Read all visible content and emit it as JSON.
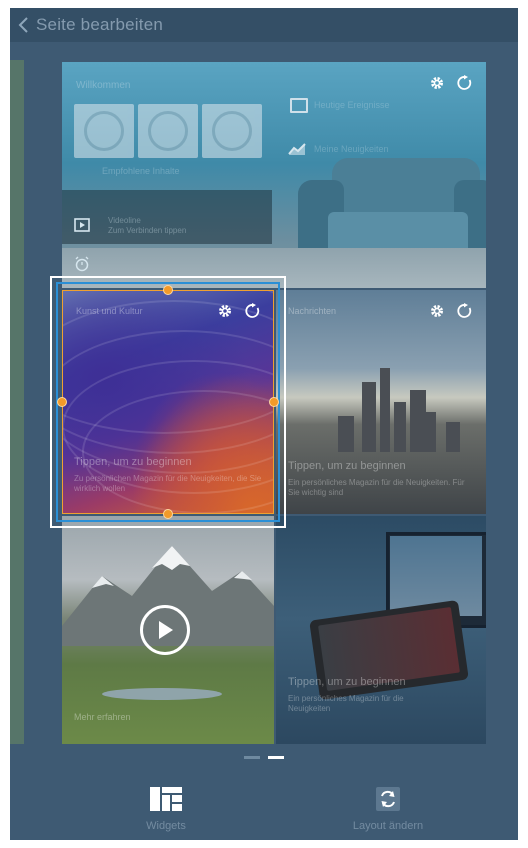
{
  "header": {
    "title": "Seite bearbeiten"
  },
  "panels": [
    {
      "id": "home",
      "widget_title": "Willkommen",
      "widget_subtitle": "Empfohlene Inhalte",
      "side_items": [
        "Heutige Ereignisse",
        "Meine Neuigkeiten"
      ],
      "left_items": [
        "Videoline",
        "Zum Verbinden tippen"
      ],
      "icons": [
        "gear-icon",
        "refresh-icon",
        "calendar-icon",
        "chart-icon",
        "video-icon",
        "alarm-icon"
      ]
    },
    {
      "id": "colorful",
      "title": "Kunst und Kultur",
      "hint": "Tippen, um zu beginnen",
      "hint_detail": "Zu persönlichen Magazin für die Neuigkeiten, die Sie wirklich wollen",
      "selected": true,
      "icons": [
        "gear-icon",
        "refresh-icon"
      ]
    },
    {
      "id": "city",
      "title": "Nachrichten",
      "hint": "Tippen, um zu beginnen",
      "hint_detail": "Ein persönliches Magazin für die Neuigkeiten. Für Sie wichtig sind",
      "icons": [
        "gear-icon",
        "refresh-icon"
      ]
    },
    {
      "id": "mountains",
      "hint": "Mehr erfahren",
      "icons": [
        "play-icon"
      ]
    },
    {
      "id": "tablet",
      "hint": "Tippen, um zu beginnen",
      "hint_detail": "Ein persönliches Magazin für die Neuigkeiten"
    }
  ],
  "page_indicator": {
    "count": 2,
    "active": 1
  },
  "bottom_bar": {
    "widgets_label": "Widgets",
    "layout_label": "Layout ändern"
  },
  "colors": {
    "background": "#3e5a73",
    "selection": "#2a8fd6",
    "handle": "#f29a2a"
  }
}
